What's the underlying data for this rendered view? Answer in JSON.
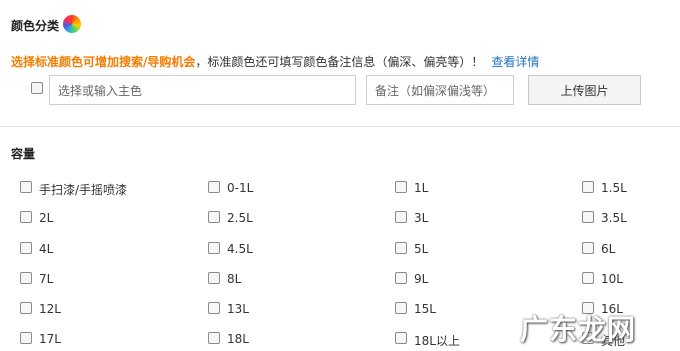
{
  "color_section": {
    "title": "颜色分类",
    "hint_orange": "选择标准颜色可增加搜索/导购机会",
    "hint_text": "，标准颜色还可填写颜色备注信息（偏深、偏亮等）！",
    "hint_link": "查看详情",
    "main_color_placeholder": "选择或输入主色",
    "note_placeholder": "备注（如偏深偏浅等）",
    "upload_label": "上传图片"
  },
  "capacity_section": {
    "title": "容量",
    "options": [
      "手扫漆/手摇喷漆",
      "0-1L",
      "1L",
      "1.5L",
      "2L",
      "2.5L",
      "3L",
      "3.5L",
      "4L",
      "4.5L",
      "5L",
      "6L",
      "7L",
      "8L",
      "9L",
      "10L",
      "12L",
      "13L",
      "15L",
      "16L",
      "17L",
      "18L",
      "18L以上",
      "其他"
    ]
  },
  "watermark": "广东龙网"
}
